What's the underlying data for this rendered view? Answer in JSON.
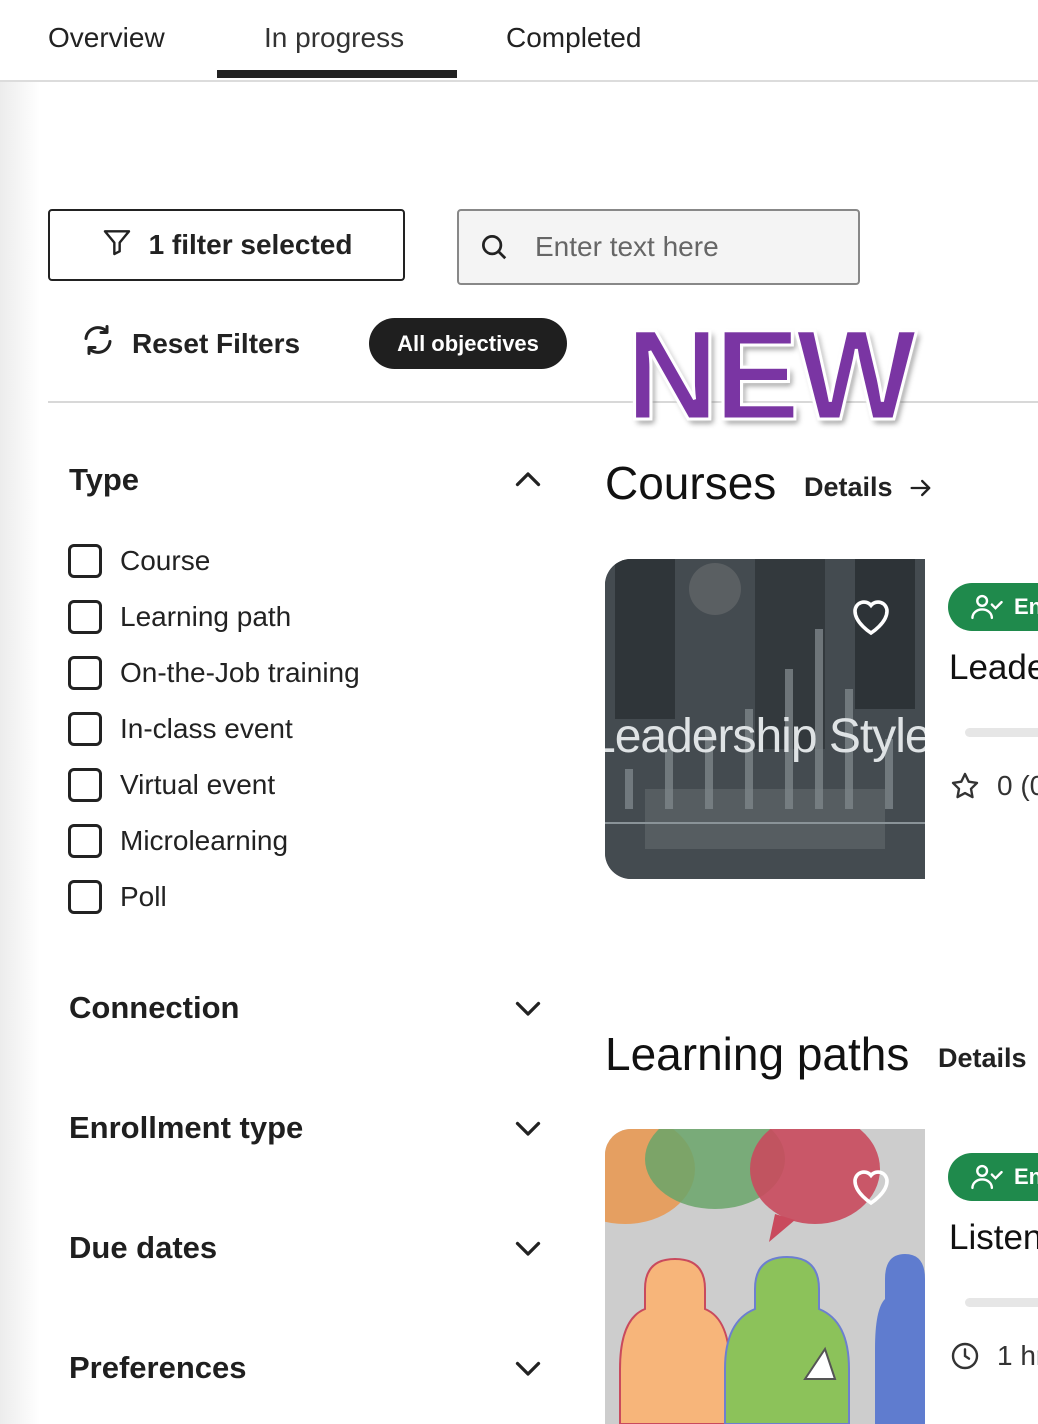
{
  "tabs": [
    {
      "label": "Overview"
    },
    {
      "label": "In progress",
      "active": true
    },
    {
      "label": "Completed"
    }
  ],
  "toolbar": {
    "filter_label": "1 filter selected",
    "search_placeholder": "Enter text here",
    "reset_label": "Reset Filters",
    "objectives_label": "All objectives"
  },
  "badge": {
    "text": "NEW",
    "color": "#7a35a3"
  },
  "filters": {
    "type": {
      "title": "Type",
      "expanded": true,
      "options": [
        {
          "label": "Course",
          "checked": false
        },
        {
          "label": "Learning path",
          "checked": false
        },
        {
          "label": "On-the-Job training",
          "checked": false
        },
        {
          "label": "In-class event",
          "checked": false
        },
        {
          "label": "Virtual event",
          "checked": false
        },
        {
          "label": "Microlearning",
          "checked": false
        },
        {
          "label": "Poll",
          "checked": false
        }
      ]
    },
    "connection": {
      "title": "Connection",
      "expanded": false
    },
    "enrollment": {
      "title": "Enrollment type",
      "expanded": false
    },
    "due_dates": {
      "title": "Due dates",
      "expanded": false
    },
    "preferences": {
      "title": "Preferences",
      "expanded": false
    }
  },
  "courses": {
    "heading": "Courses",
    "details_label": "Details",
    "card": {
      "image_text": "Leadership Style",
      "badge_text": "En",
      "title": "Leade",
      "rating_text": "0 (0"
    }
  },
  "learning_paths": {
    "heading": "Learning paths",
    "details_label": "Details",
    "card": {
      "badge_text": "En",
      "title": "Listen",
      "duration_text": "1 hr"
    }
  },
  "colors": {
    "accent_dark": "#1f1f1f",
    "enroll_green": "#1f8a4c",
    "new_purple": "#7a35a3"
  }
}
